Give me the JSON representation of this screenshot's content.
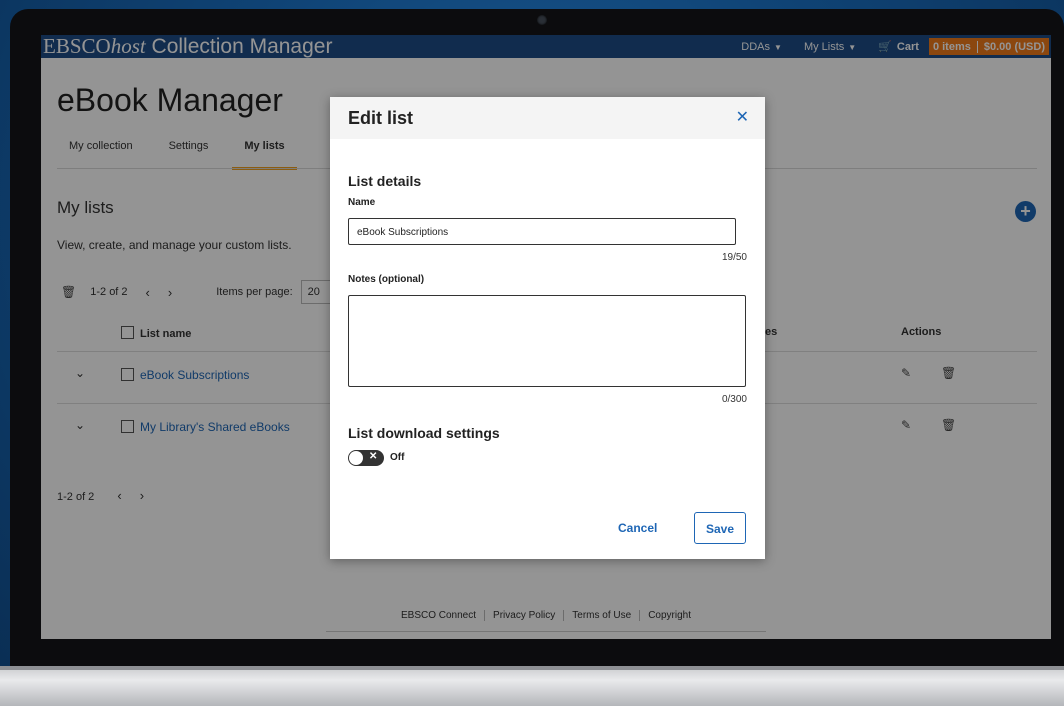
{
  "topbar": {
    "brand_prefix": "EBSCO",
    "brand_host": "host",
    "brand_suffix": " Collection Manager",
    "nav": [
      {
        "label": "DDAs"
      },
      {
        "label": "My Lists"
      }
    ],
    "cart_label": "Cart",
    "cart_items": "0 items",
    "cart_total": "$0.00 (USD)"
  },
  "page": {
    "title": "eBook Manager",
    "tabs": [
      {
        "label": "My collection"
      },
      {
        "label": "Settings"
      },
      {
        "label": "My lists"
      }
    ],
    "section_title": "My lists",
    "section_desc": "View, create, and manage your custom lists.",
    "pager_range": "1-2 of 2",
    "items_per_page_label": "Items per page:",
    "items_per_page_value": "20",
    "columns": {
      "list_name": "List name",
      "notes_partial": "es",
      "actions": "Actions"
    },
    "rows": [
      {
        "name": "eBook Subscriptions"
      },
      {
        "name": "My Library's Shared eBooks"
      }
    ],
    "bottom_pager_range": "1-2 of 2"
  },
  "footer": {
    "links": [
      "EBSCO Connect",
      "Privacy Policy",
      "Terms of Use",
      "Copyright"
    ]
  },
  "modal": {
    "title": "Edit list",
    "list_details_heading": "List details",
    "name_label": "Name",
    "name_value": "eBook Subscriptions",
    "name_count": "19/50",
    "notes_label": "Notes (optional)",
    "notes_value": "",
    "notes_count": "0/300",
    "download_heading": "List download settings",
    "toggle_state": "Off",
    "cancel_label": "Cancel",
    "save_label": "Save"
  },
  "colors": {
    "nav_bg": "#1e4d87",
    "cart_accent": "#f07a1a",
    "link_blue": "#1e66b5",
    "tab_accent": "#f0a020"
  },
  "icons": {
    "close": "close-icon",
    "add": "plus-circle-icon",
    "delete": "trash-icon",
    "edit": "edit-icon",
    "cart": "cart-icon",
    "expand": "chevron-down-icon"
  }
}
